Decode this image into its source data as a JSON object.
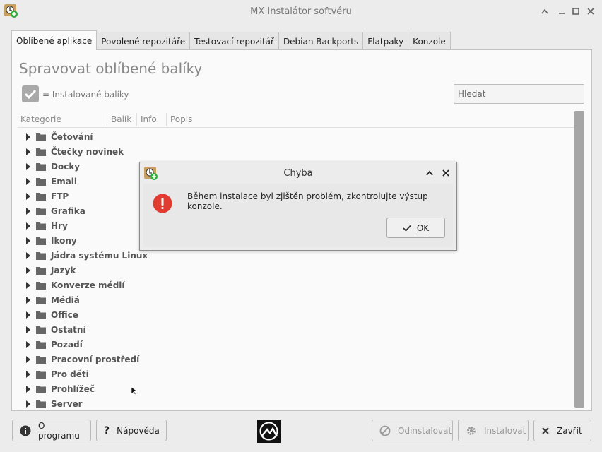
{
  "window": {
    "title": "MX Instalátor softvéru",
    "controls": [
      "chevron-up-icon",
      "minimize-icon",
      "maximize-icon",
      "close-icon"
    ]
  },
  "tabs": [
    {
      "label": "Oblíbené aplikace",
      "active": true
    },
    {
      "label": "Povolené repozitáře",
      "active": false
    },
    {
      "label": "Testovací repozitář",
      "active": false
    },
    {
      "label": "Debian Backports",
      "active": false
    },
    {
      "label": "Flatpaky",
      "active": false
    },
    {
      "label": "Konzole",
      "active": false
    }
  ],
  "panel": {
    "title": "Spravovat oblíbené balíky",
    "legend": "= Instalované balíky",
    "search_placeholder": "Hledat",
    "columns": [
      "Kategorie",
      "Balík",
      "Info",
      "Popis"
    ],
    "categories": [
      "Četování",
      "Čtečky novinek",
      "Docky",
      "Email",
      "FTP",
      "Grafika",
      "Hry",
      "Ikony",
      "Jádra systému Linux",
      "Jazyk",
      "Konverze médií",
      "Médiá",
      "Office",
      "Ostatní",
      "Pozadí",
      "Pracovní prostředí",
      "Pro děti",
      "Prohlížeč",
      "Server"
    ]
  },
  "buttons": {
    "about": "O programu",
    "help": "Nápověda",
    "uninstall": "Odinstalovat",
    "install": "Instalovat",
    "close": "Zavřít"
  },
  "dialog": {
    "title": "Chyba",
    "message": "Během instalace byl zjištěn problém, zkontrolujte výstup konzole.",
    "ok_label": "OK"
  },
  "colors": {
    "error": "#e03c31",
    "background": "#ececec",
    "panel": "#fafafa"
  }
}
